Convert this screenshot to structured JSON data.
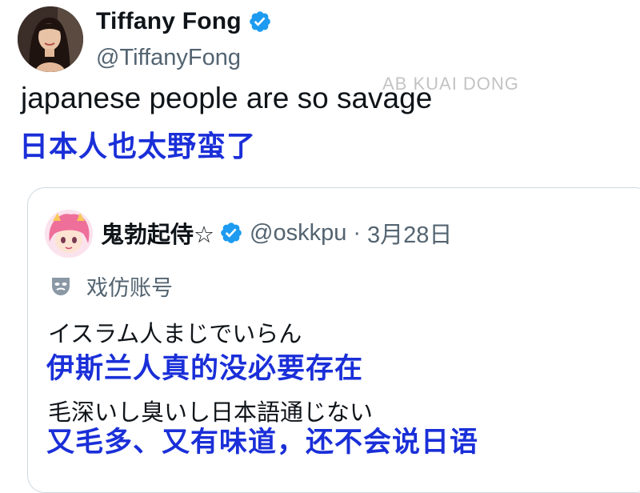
{
  "tweet": {
    "display_name": "Tiffany Fong",
    "handle": "@TiffanyFong",
    "text": "japanese people are so savage",
    "translation": "日本人也太野蛮了"
  },
  "watermark": {
    "text": "AB KUAI DONG"
  },
  "quoted_tweet": {
    "display_name": "鬼勃起侍☆",
    "handle": "@oskkpu",
    "separator": "·",
    "date": "3月28日",
    "parody_label": "戏仿账号",
    "lines": [
      "イスラム人まじでいらん",
      "伊斯兰人真的没必要存在",
      "毛深いし臭いし日本語通じない",
      "又毛多、又有味道，还不会说日语"
    ]
  },
  "colors": {
    "verified": "#1d9bf0",
    "translation_blue": "#1a2fd8",
    "secondary_text": "#536471",
    "border": "#cfd9de"
  },
  "icons": [
    "verified-badge-icon",
    "parody-mask-icon"
  ]
}
